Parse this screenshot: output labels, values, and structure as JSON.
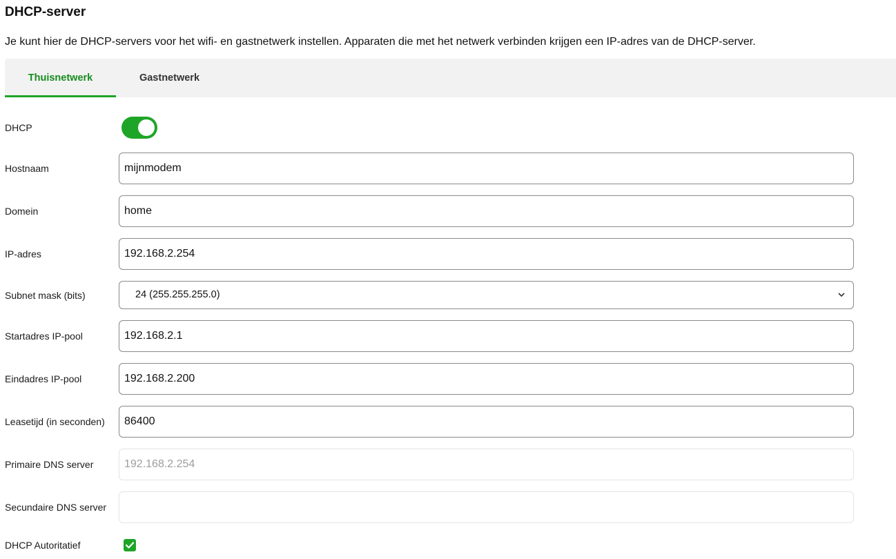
{
  "page": {
    "title": "DHCP-server",
    "description": "Je kunt hier de DHCP-servers voor het wifi- en gastnetwerk instellen. Apparaten die met het netwerk verbinden krijgen een IP-adres van de DHCP-server."
  },
  "tabs": [
    {
      "label": "Thuisnetwerk",
      "active": true
    },
    {
      "label": "Gastnetwerk",
      "active": false
    }
  ],
  "form": {
    "dhcp": {
      "label": "DHCP",
      "enabled": true
    },
    "hostname": {
      "label": "Hostnaam",
      "value": "mijnmodem"
    },
    "domain": {
      "label": "Domein",
      "value": "home"
    },
    "ip": {
      "label": "IP-adres",
      "value": "192.168.2.254"
    },
    "subnet": {
      "label": "Subnet mask (bits)",
      "value": "24 (255.255.255.0)"
    },
    "pool_start": {
      "label": "Startadres IP-pool",
      "value": "192.168.2.1"
    },
    "pool_end": {
      "label": "Eindadres IP-pool",
      "value": "192.168.2.200"
    },
    "lease": {
      "label": "Leasetijd (in seconden)",
      "value": "86400"
    },
    "dns_primary": {
      "label": "Primaire DNS server",
      "value": "192.168.2.254",
      "disabled": true
    },
    "dns_secondary": {
      "label": "Secundaire DNS server",
      "value": ""
    },
    "authoritative": {
      "label": "DHCP Autoritatief",
      "checked": true
    }
  },
  "colors": {
    "accent": "#1ea528",
    "tab_active_text": "#178c1f",
    "tabbar_bg": "#f2f2f2"
  },
  "icons": {
    "subnet_dropdown": "chevron-down-icon",
    "checkbox": "checkmark-icon"
  }
}
